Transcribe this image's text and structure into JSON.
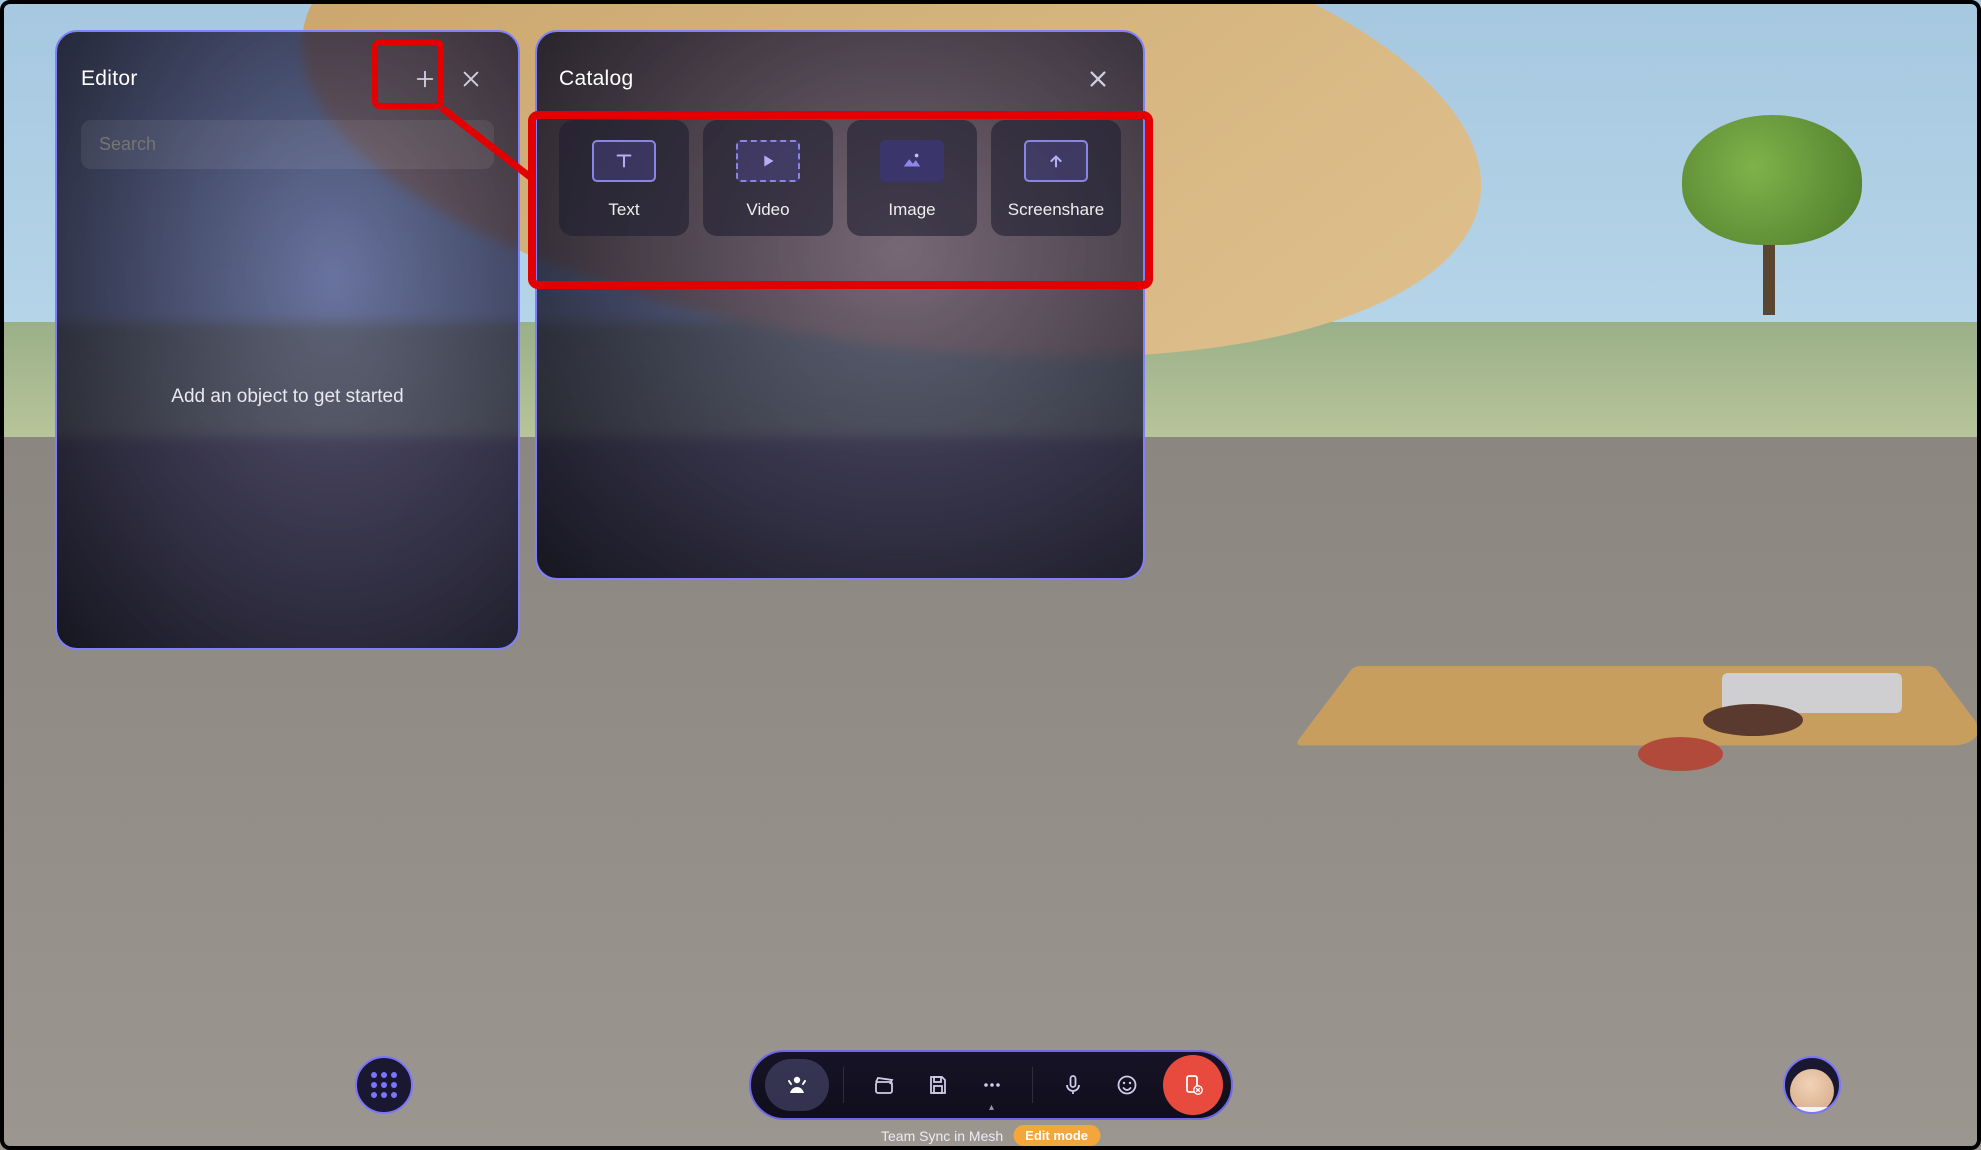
{
  "editor": {
    "title": "Editor",
    "search_placeholder": "Search",
    "empty_message": "Add an object to get started"
  },
  "catalog": {
    "title": "Catalog",
    "items": [
      {
        "label": "Text",
        "icon": "text"
      },
      {
        "label": "Video",
        "icon": "video"
      },
      {
        "label": "Image",
        "icon": "image"
      },
      {
        "label": "Screenshare",
        "icon": "screenshare"
      }
    ]
  },
  "toolbar": {
    "buttons": [
      {
        "name": "avatar-pose",
        "icon": "avatar-pose"
      },
      {
        "name": "clapper",
        "icon": "clapper"
      },
      {
        "name": "save",
        "icon": "save"
      },
      {
        "name": "more",
        "icon": "more",
        "chevron": true
      },
      {
        "name": "mic",
        "icon": "mic"
      },
      {
        "name": "emoji",
        "icon": "emoji"
      },
      {
        "name": "leave",
        "icon": "leave",
        "red": true
      }
    ]
  },
  "status": {
    "session_name": "Team Sync in Mesh",
    "mode_label": "Edit mode"
  },
  "colors": {
    "panel_border": "#8080ff",
    "highlight": "#e30000",
    "toolbar_border": "#6e67e8",
    "mode_pill": "#f2a63b",
    "leave_button": "#e84b3d"
  }
}
